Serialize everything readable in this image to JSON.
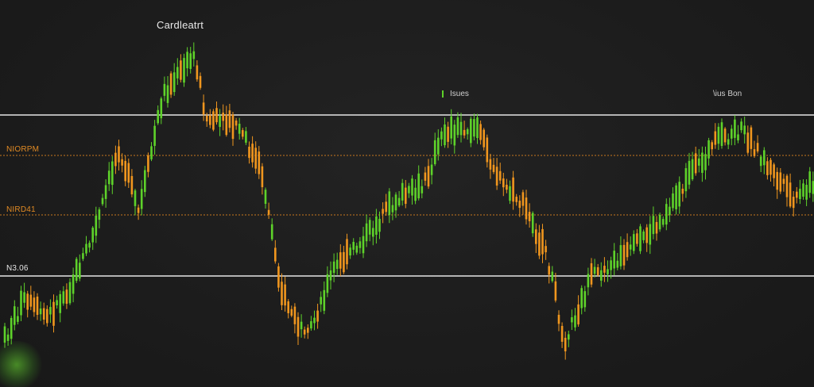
{
  "chart_data": {
    "type": "candlestick",
    "title": "Cardleatrt",
    "legend": [
      {
        "label": "Isues",
        "color": "#5ed22a"
      },
      {
        "label": "\\ius Bon",
        "color": ""
      }
    ],
    "colors": {
      "up": "#5ed22a",
      "down": "#f0961e",
      "background": "#1c1c1c",
      "solid_line": "#e6e6e6",
      "dashed_line": "#c8781e"
    },
    "reference_lines": [
      {
        "label": "",
        "value": 145,
        "style": "solid",
        "color": "#e6e6e6"
      },
      {
        "label": "NIORPM",
        "value": 196,
        "style": "dashed",
        "color": "#c8781e"
      },
      {
        "label": "NIRD41",
        "value": 271,
        "style": "dashed",
        "color": "#c8781e"
      },
      {
        "label": "N3.06",
        "value": 348,
        "style": "solid",
        "color": "#e6e6e6"
      }
    ],
    "price_path": [
      [
        0,
        440
      ],
      [
        30,
        380
      ],
      [
        60,
        400
      ],
      [
        90,
        360
      ],
      [
        120,
        290
      ],
      [
        150,
        185
      ],
      [
        175,
        270
      ],
      [
        205,
        120
      ],
      [
        245,
        70
      ],
      [
        260,
        150
      ],
      [
        300,
        160
      ],
      [
        330,
        220
      ],
      [
        355,
        370
      ],
      [
        385,
        430
      ],
      [
        420,
        340
      ],
      [
        460,
        300
      ],
      [
        500,
        250
      ],
      [
        530,
        240
      ],
      [
        560,
        165
      ],
      [
        600,
        160
      ],
      [
        630,
        230
      ],
      [
        660,
        260
      ],
      [
        690,
        330
      ],
      [
        710,
        430
      ],
      [
        745,
        350
      ],
      [
        790,
        320
      ],
      [
        830,
        280
      ],
      [
        870,
        220
      ],
      [
        905,
        175
      ],
      [
        935,
        165
      ],
      [
        970,
        215
      ],
      [
        1000,
        255
      ],
      [
        1024,
        230
      ]
    ],
    "grid": false
  }
}
